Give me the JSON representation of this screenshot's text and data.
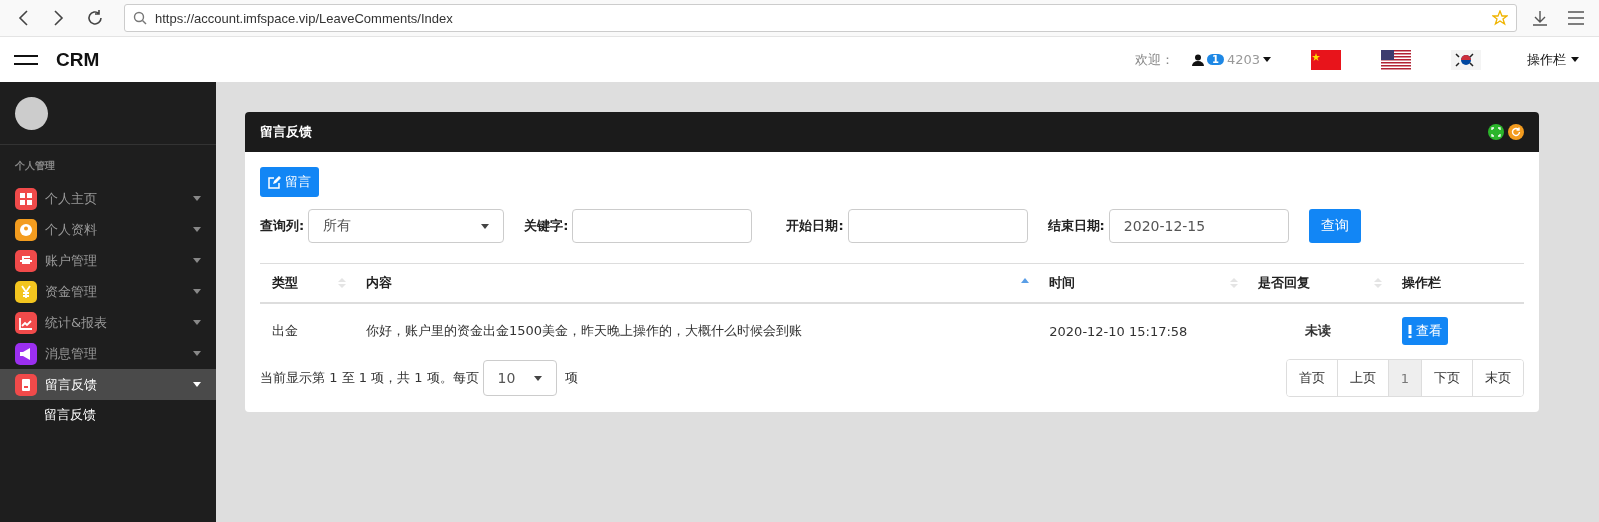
{
  "browser": {
    "url": "https://account.imfspace.vip/LeaveComments/Index"
  },
  "header": {
    "logo": "CRM",
    "welcome": "欢迎：",
    "badge": "1",
    "user": "4203",
    "menu": "操作栏"
  },
  "sidebar": {
    "section": "个人管理",
    "items": [
      {
        "label": "个人主页",
        "color": "#f04a4a",
        "selected": false
      },
      {
        "label": "个人资料",
        "color": "#f39c1f",
        "selected": false
      },
      {
        "label": "账户管理",
        "color": "#f04a4a",
        "selected": false
      },
      {
        "label": "资金管理",
        "color": "#f3c51f",
        "selected": false
      },
      {
        "label": "统计&报表",
        "color": "#f04a4a",
        "selected": false
      },
      {
        "label": "消息管理",
        "color": "#9b2ff0",
        "selected": false
      },
      {
        "label": "留言反馈",
        "color": "#f04a4a",
        "selected": true,
        "children": [
          {
            "label": "留言反馈"
          }
        ]
      }
    ]
  },
  "panel": {
    "title": "留言反馈",
    "new_button": "留言",
    "filters": {
      "column_label": "查询列:",
      "column_value": "所有",
      "keyword_label": "关键字:",
      "start_label": "开始日期:",
      "end_label": "结束日期:",
      "end_value": "2020-12-15",
      "search_button": "查询"
    },
    "table": {
      "columns": [
        {
          "label": "类型",
          "sortable": true,
          "sorted": false
        },
        {
          "label": "内容",
          "sortable": true,
          "sorted": true
        },
        {
          "label": "时间",
          "sortable": true,
          "sorted": false
        },
        {
          "label": "是否回复",
          "sortable": true,
          "sorted": false
        },
        {
          "label": "操作栏",
          "sortable": false
        }
      ],
      "rows": [
        {
          "type": "出金",
          "content": "你好，账户里的资金出金1500美金，昨天晚上操作的，大概什么时候会到账",
          "time": "2020-12-10 15:17:58",
          "reply": "未读",
          "action": "查看"
        }
      ]
    },
    "footer": {
      "info": "当前显示第 1 至 1 项，共 1 项。每页",
      "page_size": "10",
      "unit": "项"
    },
    "pagination": [
      {
        "label": "首页",
        "selected": false
      },
      {
        "label": "上页",
        "selected": false
      },
      {
        "label": "1",
        "selected": true
      },
      {
        "label": "下页",
        "selected": false
      },
      {
        "label": "末页",
        "selected": false
      }
    ]
  }
}
